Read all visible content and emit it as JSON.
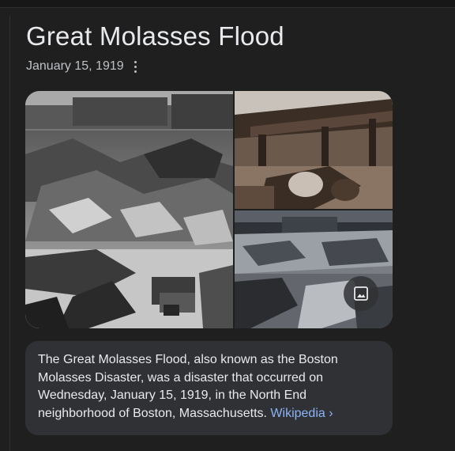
{
  "title": "Great Molasses Flood",
  "date": "January 15, 1919",
  "more_icon": "more-vert-icon",
  "gallery": {
    "images": [
      {
        "name": "flood-aftermath-wide"
      },
      {
        "name": "elevated-railway-wreckage"
      },
      {
        "name": "flood-aftermath-crowd"
      }
    ],
    "images_button_icon": "image-icon"
  },
  "description": {
    "text": "The Great Molasses Flood, also known as the Boston Molasses Disaster, was a disaster that occurred on Wednesday, January 15, 1919, in the North End neighborhood of Boston, Massachusetts.",
    "source_label": "Wikipedia",
    "source_chevron": "›"
  },
  "colors": {
    "background": "#1f1f1f",
    "text": "#e8eaed",
    "secondary_text": "#bdc1c6",
    "card": "#303134",
    "link": "#8ab4f8"
  }
}
